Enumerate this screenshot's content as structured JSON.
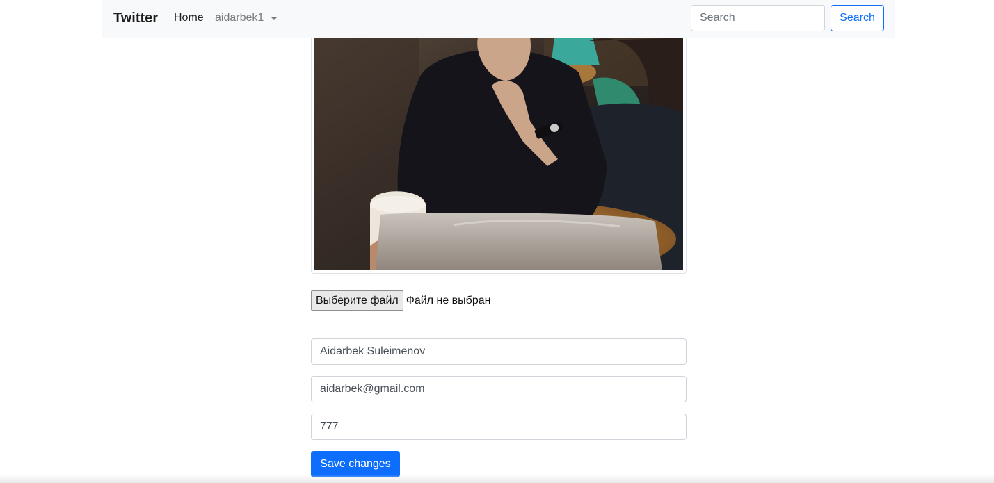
{
  "navbar": {
    "brand": "Twitter",
    "home_label": "Home",
    "user_label": "aidarbek1",
    "search_placeholder": "Search",
    "search_button": "Search"
  },
  "profile": {
    "photo_alt": "profile photo"
  },
  "file_input": {
    "button_label": "Выберите файл",
    "status": "Файл не выбран"
  },
  "form": {
    "name_value": "Aidarbek Suleimenov",
    "email_value": "aidarbek@gmail.com",
    "phone_value": "777",
    "save_label": "Save changes"
  },
  "colors": {
    "primary": "#0d6efd",
    "navbar_bg": "#f8f9fa"
  }
}
